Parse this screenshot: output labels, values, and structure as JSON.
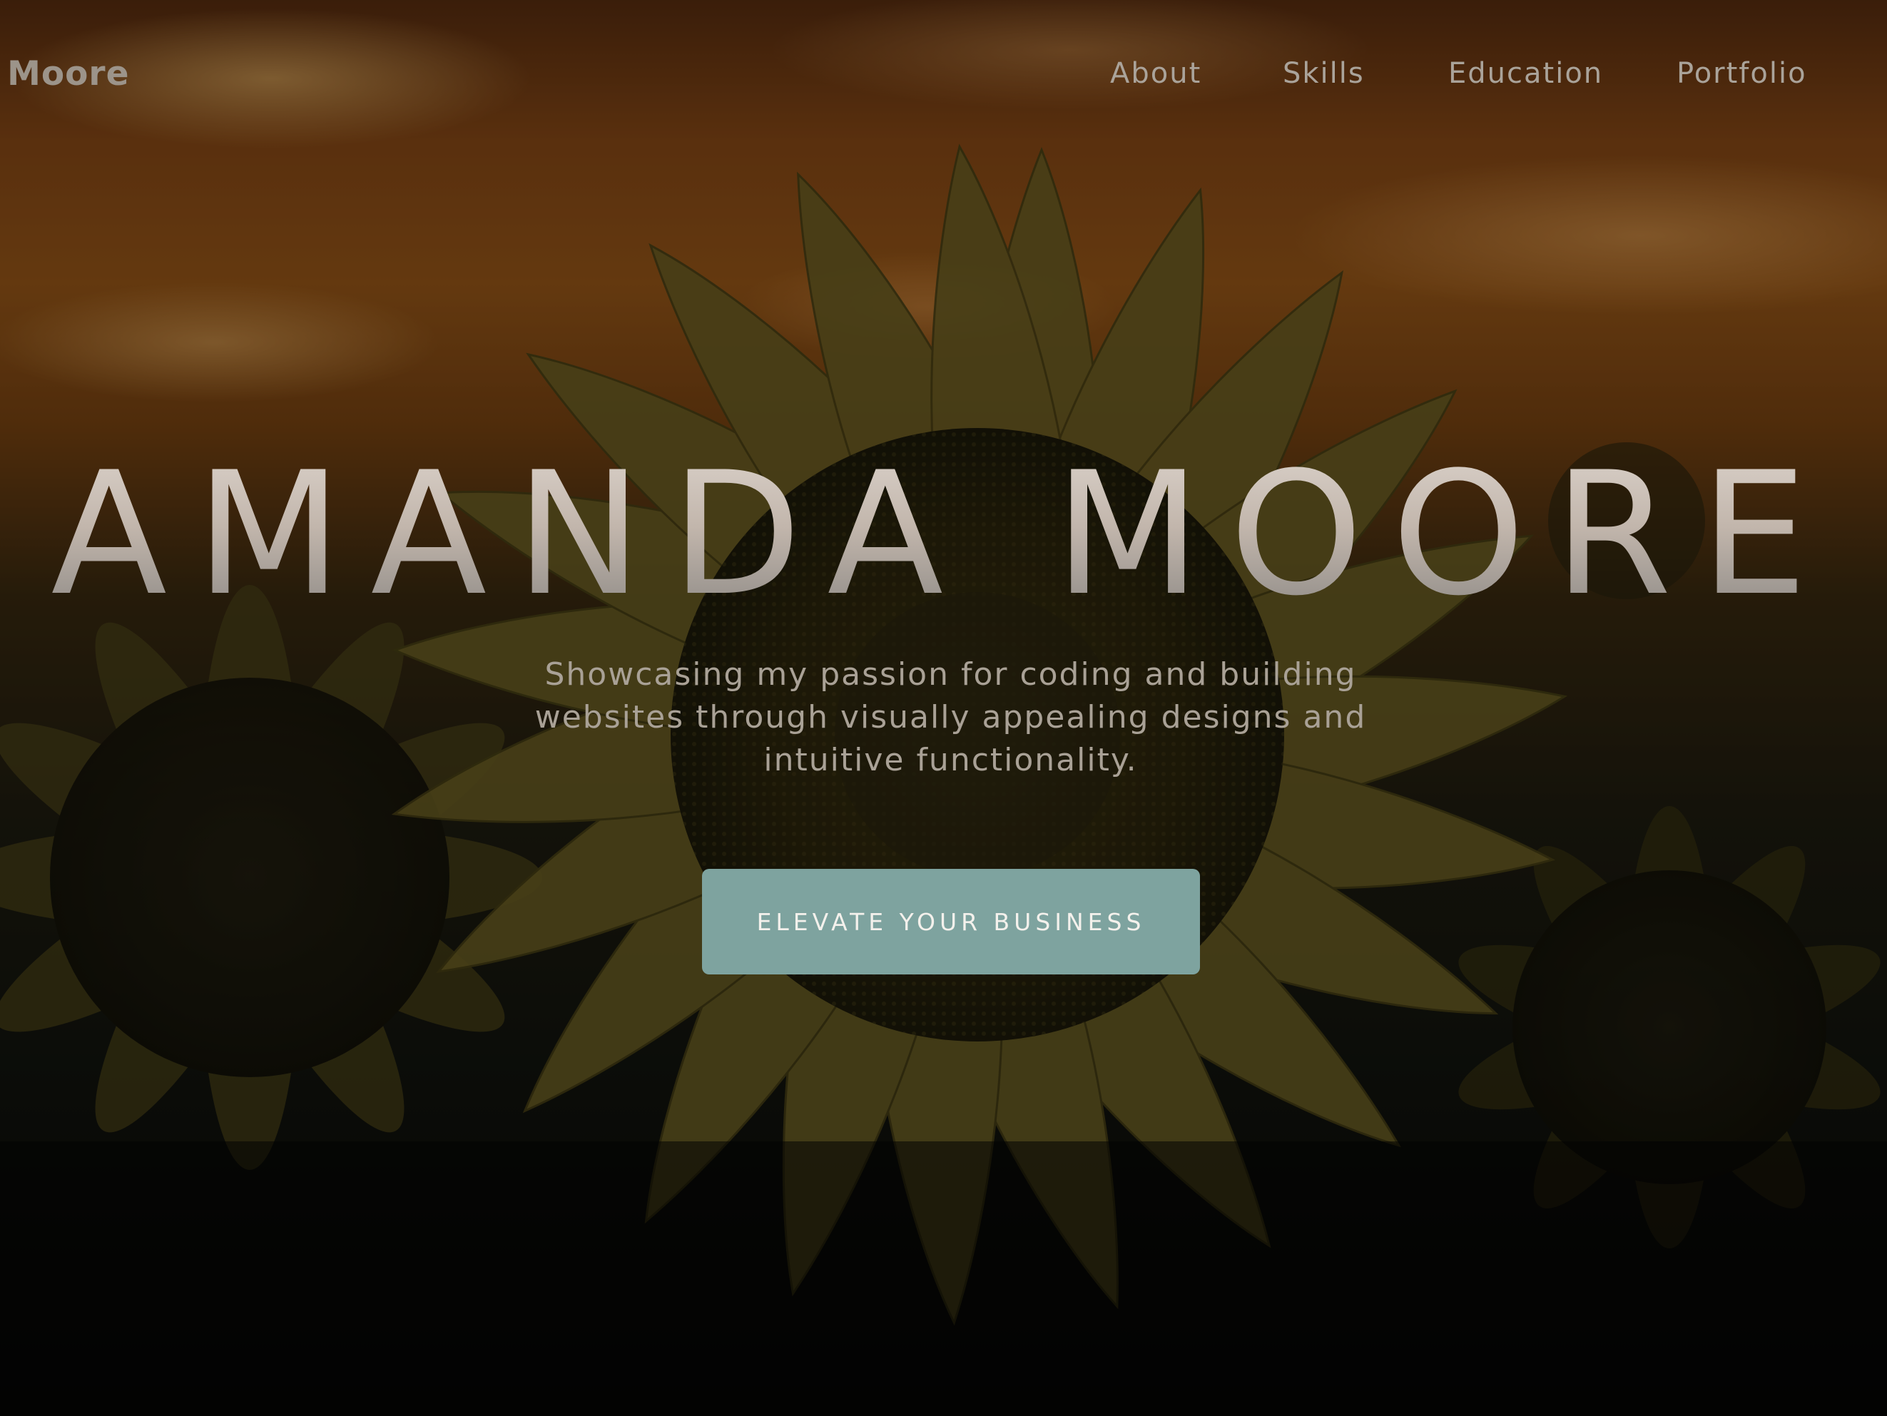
{
  "nav": {
    "brand": "a Moore",
    "links": [
      {
        "label": "About"
      },
      {
        "label": "Skills"
      },
      {
        "label": "Education"
      },
      {
        "label": "Portfolio"
      }
    ]
  },
  "hero": {
    "title": "AMANDA MOORE",
    "subtitle": "Showcasing my passion for coding and building websites through visually appealing designs and intuitive functionality.",
    "cta_label": "ELEVATE YOUR BUSINESS"
  },
  "colors": {
    "accent": "#7ea39f",
    "nav_text": "#aaa39a",
    "title_text": "#c9bfb6"
  },
  "background": {
    "subject": "sunflower-field-at-sunset"
  }
}
